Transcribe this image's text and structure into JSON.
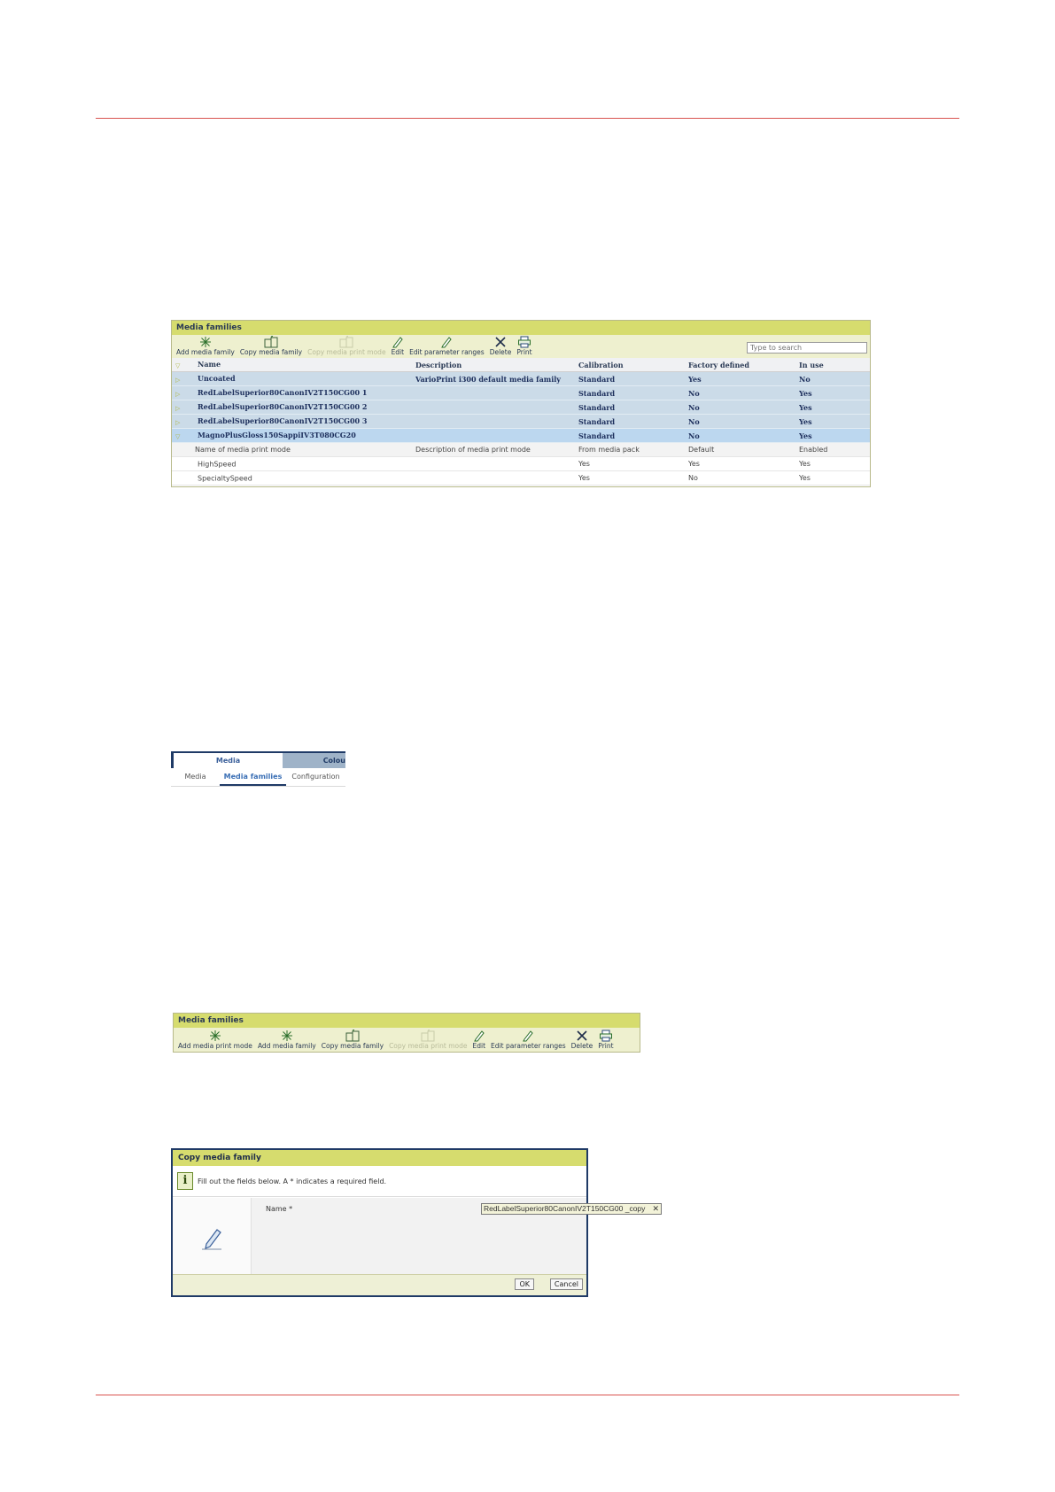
{
  "figure1": {
    "title": "Media families",
    "toolbar": [
      {
        "label": "Add media family",
        "icon": "sparkle-add-icon",
        "disabled": false
      },
      {
        "label": "Copy media family",
        "icon": "copy-icon",
        "disabled": false
      },
      {
        "label": "Copy media print mode",
        "icon": "copy-icon",
        "disabled": true
      },
      {
        "label": "Edit",
        "icon": "pencil-icon",
        "disabled": false
      },
      {
        "label": "Edit parameter ranges",
        "icon": "pencil-icon",
        "disabled": false
      },
      {
        "label": "Delete",
        "icon": "x-icon",
        "disabled": false
      },
      {
        "label": "Print",
        "icon": "printer-icon",
        "disabled": false
      }
    ],
    "search_placeholder": "Type to search",
    "columns": [
      "Name",
      "Description",
      "Calibration",
      "Factory defined",
      "In use"
    ],
    "families": [
      {
        "name": "Uncoated",
        "description": "VarioPrint i300 default media family",
        "calibration": "Standard",
        "factory": "Yes",
        "in_use": "No",
        "checked": false,
        "expanded": false
      },
      {
        "name": "RedLabelSuperior80CanonIV2T150CG00 1",
        "description": "",
        "calibration": "Standard",
        "factory": "No",
        "in_use": "Yes",
        "checked": false,
        "expanded": false
      },
      {
        "name": "RedLabelSuperior80CanonIV2T150CG00 2",
        "description": "",
        "calibration": "Standard",
        "factory": "No",
        "in_use": "Yes",
        "checked": false,
        "expanded": false
      },
      {
        "name": "RedLabelSuperior80CanonIV2T150CG00 3",
        "description": "",
        "calibration": "Standard",
        "factory": "No",
        "in_use": "Yes",
        "checked": false,
        "expanded": false
      },
      {
        "name": "MagnoPlusGloss150SappiIV3T080CG20",
        "description": "",
        "calibration": "Standard",
        "factory": "No",
        "in_use": "Yes",
        "checked": true,
        "expanded": true
      }
    ],
    "mode_header": {
      "name": "Name of media print mode",
      "description": "Description of media print mode",
      "calibration": "From media pack",
      "factory": "Default",
      "in_use": "Enabled"
    },
    "modes": [
      {
        "name": "HighSpeed",
        "calibration": "Yes",
        "factory": "Yes",
        "in_use": "Yes"
      },
      {
        "name": "SpecialtySpeed",
        "calibration": "Yes",
        "factory": "No",
        "in_use": "Yes"
      }
    ]
  },
  "figure2": {
    "top_tabs": [
      "Media",
      "Colou"
    ],
    "sub_tabs": [
      "Media",
      "Media families",
      "Configuration"
    ],
    "active_sub_tab": "Media families"
  },
  "figure3": {
    "title": "Media families",
    "toolbar": [
      {
        "label": "Add media print mode",
        "icon": "sparkle-add-icon",
        "disabled": false
      },
      {
        "label": "Add media family",
        "icon": "sparkle-add-icon",
        "disabled": false
      },
      {
        "label": "Copy media family",
        "icon": "copy-icon",
        "disabled": false
      },
      {
        "label": "Copy media print mode",
        "icon": "copy-icon",
        "disabled": true
      },
      {
        "label": "Edit",
        "icon": "pencil-icon",
        "disabled": false
      },
      {
        "label": "Edit parameter ranges",
        "icon": "pencil-icon",
        "disabled": false
      },
      {
        "label": "Delete",
        "icon": "x-icon",
        "disabled": false
      },
      {
        "label": "Print",
        "icon": "printer-icon",
        "disabled": false
      }
    ]
  },
  "figure4": {
    "title": "Copy media family",
    "info_text": "Fill out the fields below. A * indicates a required field.",
    "field_label": "Name *",
    "field_value": "RedLabelSuperior80CanonIV2T150CG00 _copy",
    "ok_label": "OK",
    "cancel_label": "Cancel"
  },
  "colors": {
    "rule": "#d9534f",
    "title_bar": "#d6dc6e",
    "selected_row": "#bcd7ef",
    "family_row": "#cbdbe8"
  }
}
